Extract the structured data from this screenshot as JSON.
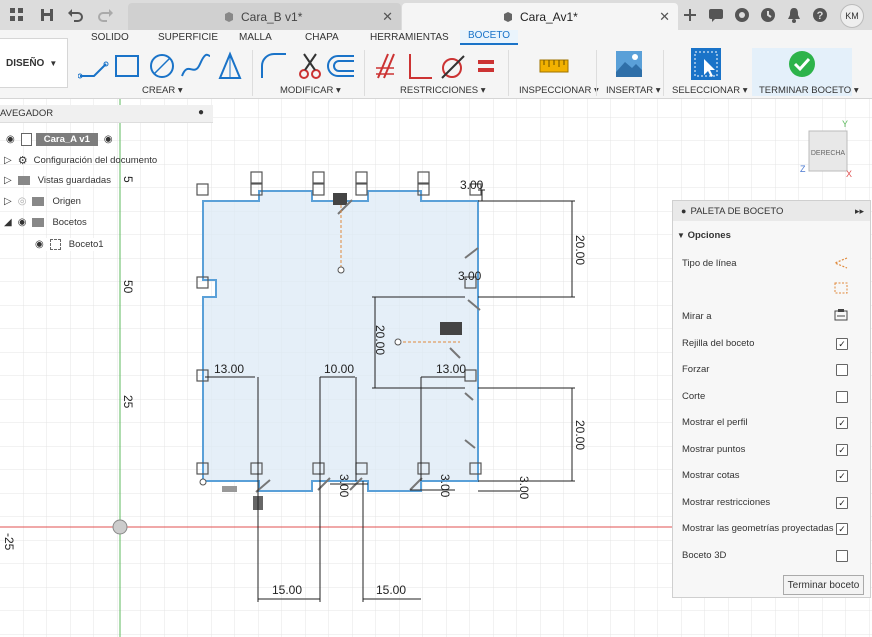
{
  "tabs": [
    {
      "label": "Cara_B v1*",
      "close": "✕"
    },
    {
      "label": "Cara_Av1*",
      "close": "✕"
    }
  ],
  "user_initials": "KM",
  "workspace": {
    "label": "DISEÑO"
  },
  "ribbon_tabs": [
    "SOLIDO",
    "SUPERFICIE",
    "MALLA",
    "CHAPA",
    "HERRAMIENTAS",
    "BOCETO"
  ],
  "active_tab": "BOCETO",
  "groups": {
    "crear": "CREAR",
    "modificar": "MODIFICAR",
    "restricciones": "RESTRICCIONES",
    "inspeccionar": "INSPECCIONAR",
    "insertar": "INSERTAR",
    "seleccionar": "SELECCIONAR",
    "terminar": "TERMINAR BOCETO"
  },
  "browser": {
    "title": "AVEGADOR",
    "root": "Cara_A v1",
    "items": [
      {
        "label": "Configuración del documento"
      },
      {
        "label": "Vistas guardadas"
      },
      {
        "label": "Origen"
      },
      {
        "label": "Bocetos"
      },
      {
        "label": "Boceto1"
      }
    ]
  },
  "viewcube": {
    "face": "DERECHA",
    "y": "Y",
    "z": "Z",
    "x": "X"
  },
  "axis_labels": {
    "top": "5",
    "v50": "50",
    "v25": "25",
    "h25": "-25"
  },
  "dimensions": {
    "d300_top": "3.00",
    "d2000_right1": "20.00",
    "d300_mid": "3.00",
    "d2000_center": "20.00",
    "d1300_left": "13.00",
    "d1000": "10.00",
    "d1300_right": "13.00",
    "d2000_right2": "20.00",
    "d300_bottom": "3.00",
    "d300_b2": "3.00",
    "d300_b3": "3.00",
    "d1500_left": "15.00",
    "d1500_right": "15.00"
  },
  "palette": {
    "title": "PALETA DE BOCETO",
    "section": "Opciones",
    "rows": [
      {
        "label": "Tipo de línea",
        "control": "icon"
      },
      {
        "label": "Mirar a",
        "control": "icon"
      },
      {
        "label": "Rejilla del boceto",
        "checked": true
      },
      {
        "label": "Forzar",
        "checked": false
      },
      {
        "label": "Corte",
        "checked": false
      },
      {
        "label": "Mostrar el perfil",
        "checked": true
      },
      {
        "label": "Mostrar puntos",
        "checked": true
      },
      {
        "label": "Mostrar cotas",
        "checked": true
      },
      {
        "label": "Mostrar restricciones",
        "checked": true
      },
      {
        "label": "Mostrar las geometrías proyectadas",
        "checked": true
      },
      {
        "label": "Boceto 3D",
        "checked": false
      }
    ],
    "finish_button": "Terminar boceto"
  },
  "colors": {
    "accent": "#1a73c8",
    "profile_fill": "#dceaf6",
    "profile_line": "#5aa0d8",
    "axis_red": "#e05050",
    "axis_green": "#5cba5c",
    "finish_green": "#2db34a"
  }
}
